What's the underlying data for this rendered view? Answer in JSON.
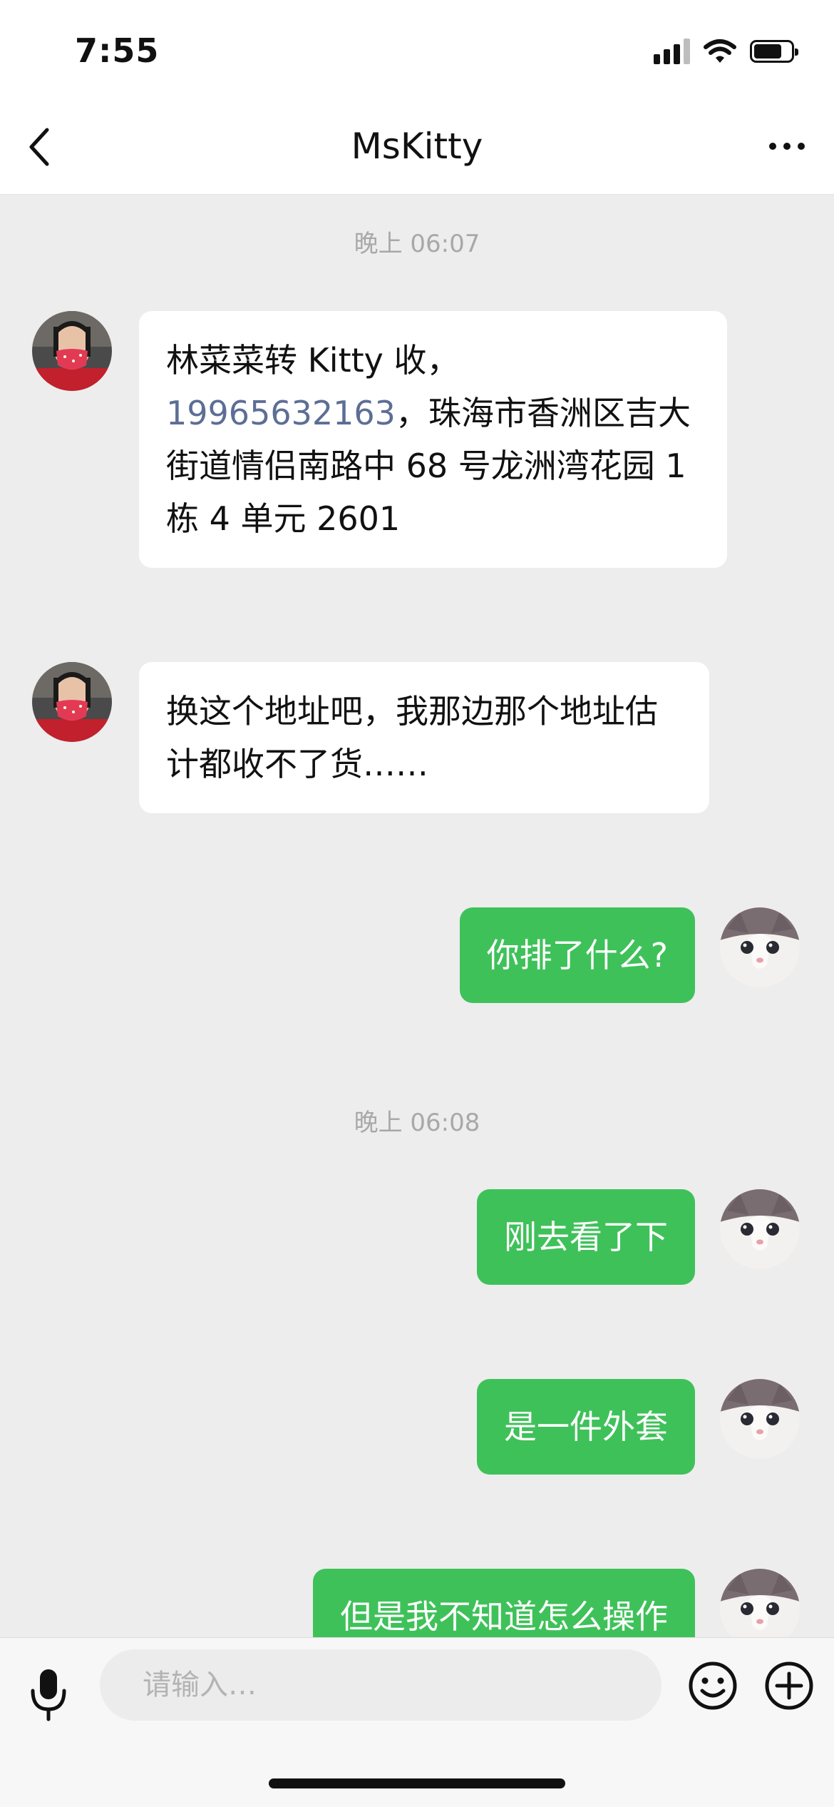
{
  "status_bar": {
    "time": "7:55",
    "signal_bars": 4,
    "signal_filled": 3,
    "battery_level": 0.75
  },
  "nav": {
    "title": "MsKitty",
    "back_icon": "chevron-left-icon",
    "more_icon": "more-dots-icon"
  },
  "chat": {
    "timestamps": [
      "晚上 06:07",
      "晚上 06:08"
    ],
    "messages": [
      {
        "from": "other",
        "text_before": "林菜菜转 Kitty 收，",
        "phone": "19965632163",
        "text_after": "，珠海市香洲区吉大街道情侣南路中 68 号龙洲湾花园 1 栋 4 单元 2601"
      },
      {
        "from": "other",
        "text": "换这个地址吧，我那边那个地址估计都收不了货……"
      },
      {
        "from": "me",
        "text": "你排了什么?"
      },
      {
        "from": "me",
        "text": "刚去看了下"
      },
      {
        "from": "me",
        "text": "是一件外套"
      },
      {
        "from": "me",
        "text": "但是我不知道怎么操作"
      }
    ]
  },
  "input": {
    "placeholder": "请输入…"
  },
  "colors": {
    "accent_green": "#3fc15a",
    "link": "#5d6e95",
    "background": "#ededed"
  }
}
